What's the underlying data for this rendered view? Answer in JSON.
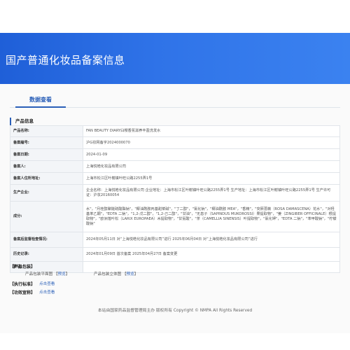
{
  "header": {
    "title": "国产普通化妆品备案信息"
  },
  "tabs": [
    {
      "label": "数据查看"
    }
  ],
  "product_info": {
    "section_title": "产品信息",
    "rows": [
      {
        "key": "产品名称:",
        "value": "FAN BEAUTY DIARY臼樱香氛滋养丰盈洗发水"
      },
      {
        "key": "备案编号:",
        "value": "沪G妆网备字2024000070"
      },
      {
        "key": "备案日期:",
        "value": "2024-01-09"
      },
      {
        "key": "备案人:",
        "value": "上海悦皓化妆品有限公司"
      },
      {
        "key": "备案人住所地址:",
        "value": "上海市松江区叶榭镇叶旺公路2255弄1号"
      },
      {
        "key": "生产企业:",
        "value": "企业名称：上海悦皓化妆品有限公司 企业地址：上海市松江区叶榭镇叶旺公路2255弄1号 生产地址：上海市松江区叶榭镇叶旺公路2255弄1号 生产许可证：沪妆20160054"
      },
      {
        "key": "成分:",
        "value": "水\"，\"月桂醇聚醚硫酸酯钠\"，\"椰油酰胺丙基甜菜碱\"，\"丁二醇\"，\"氯化钠\"，\"椰油酰胺 MEA\"，\"香精\"，\"突厥蔷薇（ROSA DAMASCENA）花水\"，\"对羟基苯乙酮\"，\"EDTA 二钠\"，\"1,2-戊二醇\"，\"1,2-己二醇\"，\"甘油\"，\"无患子（SAPINDUS MUKOROSSI）果提取物\"，\"姜（ZINGIBER OFFICINALE）根提取物\"，\"欧洲落叶松（LARIX EUROPAEA）木提取物\"，\"甘氨酸\"，\"茶（CAMELLIA SINENSIS）叶提取物\"，\"氯化钾\"，\"EDTA 二钠\"，\"苯甲酸钠\"，\"柠檬酸钠\""
      },
      {
        "key": "备案后监督检查情况:",
        "value": "2024年05月11日 对“上海悦皓化妆品有限公司”进行 2025年06月04日 对“上海悦皓化妆品有限公司”进行"
      },
      {
        "key": "历史记录:",
        "value": "2024年01月09日 首次备案 2025年04月27日 备案变更"
      },
      {
        "key": "备注:",
        "value": ""
      }
    ]
  },
  "packaging": {
    "title": "产品包装",
    "item1_label": "产品包装平面图",
    "item1_link": "预览",
    "item2_label": "产品包装立体图",
    "item2_link": "预览"
  },
  "standard": {
    "title": "执行标准",
    "link": "点击查看"
  },
  "efficacy": {
    "title": "功效宣称",
    "link": "点击查看"
  },
  "footer": {
    "text": "本站由国家药品监督管理局主办 版权所有 Copyright © NMPA All Rights Reserved"
  }
}
